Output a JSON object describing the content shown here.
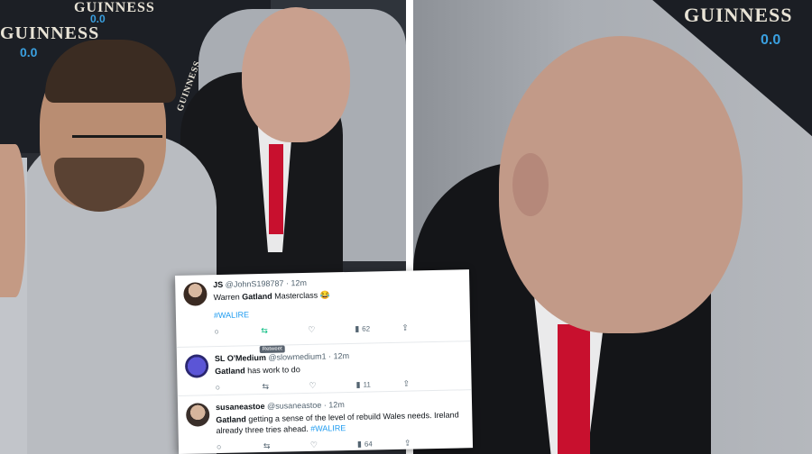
{
  "photo_left": {
    "brand_top": "GUINNESS",
    "brand_sub": "0.0",
    "brand_top2": "GUINNESS",
    "brand_sub2": "0.0",
    "brand_side": "GUINNESS"
  },
  "photo_right": {
    "brand_top": "GUINNESS",
    "brand_sub": "0.0"
  },
  "tweets": [
    {
      "name": "JS",
      "handle": "@JohnS198787",
      "time": "12m",
      "text_prefix": "Warren ",
      "text_bold": "Gatland",
      "text_suffix": " Masterclass 😂",
      "hashtag": "#WALIRE",
      "views": "62",
      "tooltip": "Retweet"
    },
    {
      "name": "SL O'Medium",
      "handle": "@slowmedium1",
      "time": "12m",
      "text_bold": "Gatland",
      "text_suffix": " has work to do",
      "views": "11"
    },
    {
      "name": "susaneastoe",
      "handle": "@susaneastoe",
      "time": "12m",
      "text_bold": "Gatland",
      "text_suffix": " getting a sense of the level of rebuild Wales needs. Ireland already three tries ahead.",
      "hashtag": "#WALIRE",
      "views": "64"
    }
  ],
  "colors": {
    "link": "#1d9bf0",
    "tie": "#c8102e",
    "hoodie": "#b9bcc1"
  }
}
